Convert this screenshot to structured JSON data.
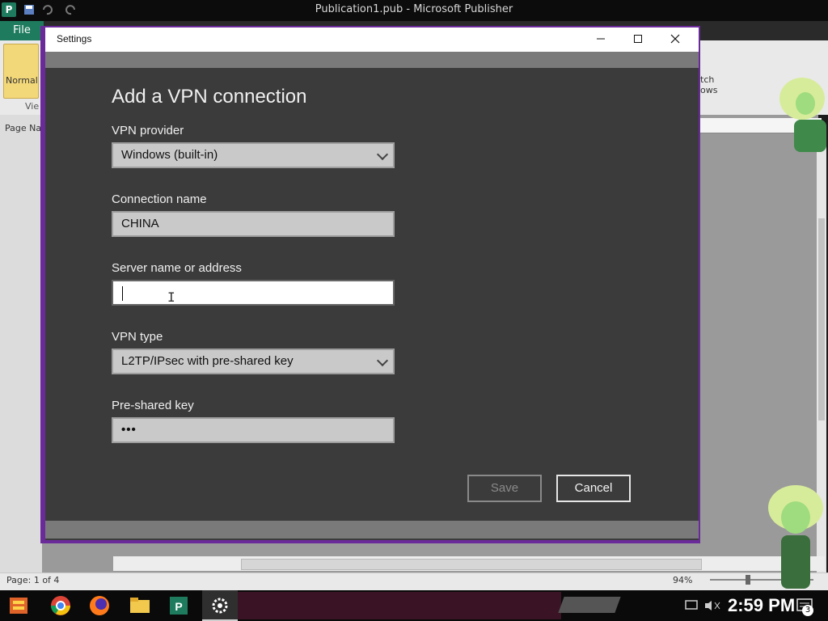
{
  "publisher": {
    "title": "Publication1.pub - Microsoft Publisher",
    "file_tab": "File",
    "normal_label": "Normal",
    "view_label": "Vie",
    "page_nav_label": "Page Nav",
    "ribbon_partial": "tch\nows",
    "status_page": "Page: 1 of 4",
    "zoom": "94%"
  },
  "dialog": {
    "window_title": "Settings",
    "heading": "Add a VPN connection",
    "fields": {
      "vpn_provider": {
        "label": "VPN provider",
        "value": "Windows (built-in)"
      },
      "connection_name": {
        "label": "Connection name",
        "value": "CHINA"
      },
      "server": {
        "label": "Server name or address",
        "value": ""
      },
      "vpn_type": {
        "label": "VPN type",
        "value": "L2TP/IPsec with pre-shared key"
      },
      "preshared_key": {
        "label": "Pre-shared key",
        "value": "•••"
      }
    },
    "buttons": {
      "save": "Save",
      "cancel": "Cancel"
    }
  },
  "taskbar": {
    "clock": "2:59 PM",
    "notification_count": "3",
    "pinned": [
      "start-icon",
      "chrome-icon",
      "firefox-icon",
      "folder-icon",
      "publisher-icon",
      "settings-gear-icon"
    ]
  },
  "colors": {
    "dialog_bg": "#3b3b3b",
    "accent_border": "#6b2a9a",
    "publisher_green": "#1e7b5e"
  }
}
